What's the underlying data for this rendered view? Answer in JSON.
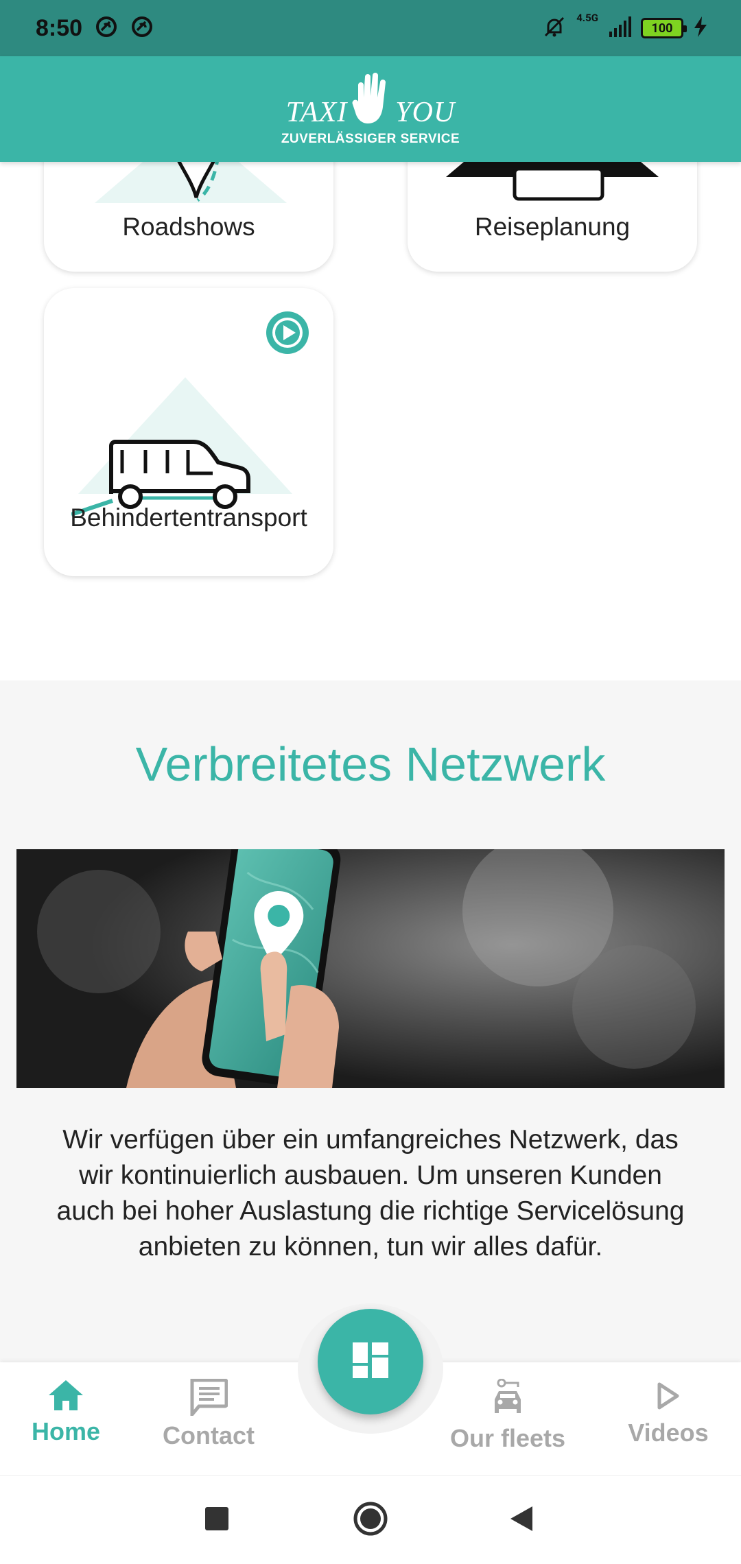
{
  "status_bar": {
    "time": "8:50",
    "network": "4.5G",
    "battery": "100",
    "icons": [
      "dnd-icon",
      "dnd-icon",
      "bell-off-icon",
      "signal-icon",
      "battery-icon",
      "charging-icon"
    ]
  },
  "header": {
    "logo_left": "TAXI",
    "logo_right": "YOU",
    "tagline": "ZUVERLÄSSIGER SERVICE"
  },
  "services": [
    {
      "label": "Roadshows",
      "icon": "location-pin-icon"
    },
    {
      "label": "Reiseplanung",
      "icon": "travel-icon"
    },
    {
      "label": "Behindertentransport",
      "icon": "van-icon",
      "badge_icon": "play-icon"
    }
  ],
  "section": {
    "title": "Verbreitetes Netzwerk",
    "text": "Wir verfügen über ein umfangreiches Netzwerk, das wir kontinuierlich ausbauen. Um unseren Kunden auch bei hoher Auslastung die richtige Servicelösung anbieten zu können, tun wir alles dafür."
  },
  "bottom_nav": {
    "items": [
      {
        "label": "Home",
        "icon": "home-icon",
        "active": true
      },
      {
        "label": "Contact",
        "icon": "message-icon",
        "active": false
      },
      {
        "label": "Our fleets",
        "icon": "car-icon",
        "active": false
      },
      {
        "label": "Videos",
        "icon": "play-outline-icon",
        "active": false
      }
    ],
    "fab_icon": "dashboard-icon"
  },
  "system_nav": {
    "icons": [
      "recent-apps-icon",
      "home-circle-icon",
      "back-icon"
    ]
  },
  "colors": {
    "accent": "#3bb5a7",
    "status_bar": "#2e8a80",
    "inactive": "#a8a8a8"
  }
}
